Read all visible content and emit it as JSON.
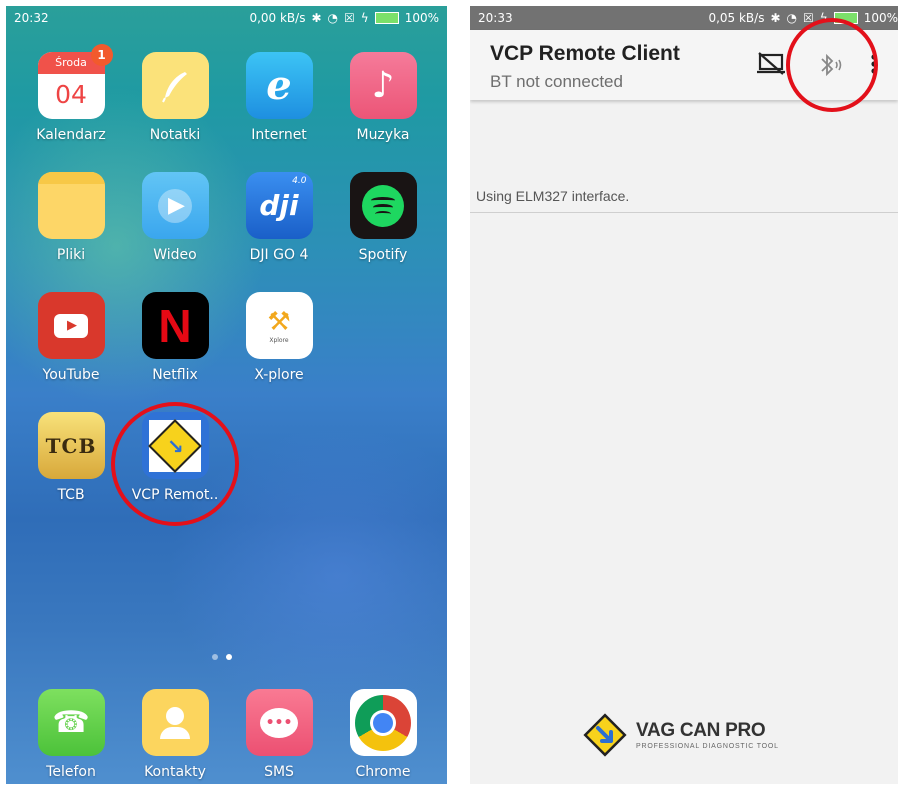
{
  "left": {
    "status": {
      "time": "20:32",
      "speed": "0,00 kB/s",
      "battery": "100%"
    },
    "apps": [
      {
        "label": "Kalendarz",
        "icon": "calendar-icon",
        "day": "Środa",
        "date": "04",
        "badge": "1"
      },
      {
        "label": "Notatki",
        "icon": "notes-icon"
      },
      {
        "label": "Internet",
        "icon": "internet-icon"
      },
      {
        "label": "Muzyka",
        "icon": "music-icon"
      },
      {
        "label": "Pliki",
        "icon": "folder-icon"
      },
      {
        "label": "Wideo",
        "icon": "video-play-icon"
      },
      {
        "label": "DJI GO 4",
        "icon": "dji-icon",
        "logo": "dji",
        "version": "4.0"
      },
      {
        "label": "Spotify",
        "icon": "spotify-icon"
      },
      {
        "label": "YouTube",
        "icon": "youtube-icon"
      },
      {
        "label": "Netflix",
        "icon": "netflix-icon",
        "logo": "N"
      },
      {
        "label": "X-plore",
        "icon": "xplore-icon",
        "small": "Xplore"
      },
      {
        "label": "TCB",
        "icon": "tcb-icon",
        "logo": "TCB"
      },
      {
        "label": "VCP Remot..",
        "icon": "vcp-app-icon"
      }
    ],
    "dock": [
      {
        "label": "Telefon",
        "icon": "phone-icon"
      },
      {
        "label": "Kontakty",
        "icon": "contacts-icon"
      },
      {
        "label": "SMS",
        "icon": "sms-icon"
      },
      {
        "label": "Chrome",
        "icon": "chrome-icon"
      }
    ]
  },
  "right": {
    "status": {
      "time": "20:33",
      "speed": "0,05 kB/s",
      "battery": "100%"
    },
    "app_title": "VCP Remote Client",
    "app_subtitle": "BT not connected",
    "log_line": "Using ELM327 interface.",
    "brand_name": "VAG CAN PRO",
    "brand_tagline": "PROFESSIONAL DIAGNOSTIC TOOL"
  },
  "colors": {
    "highlight_circle": "#e3101a",
    "status_bar_right": "#727272"
  }
}
